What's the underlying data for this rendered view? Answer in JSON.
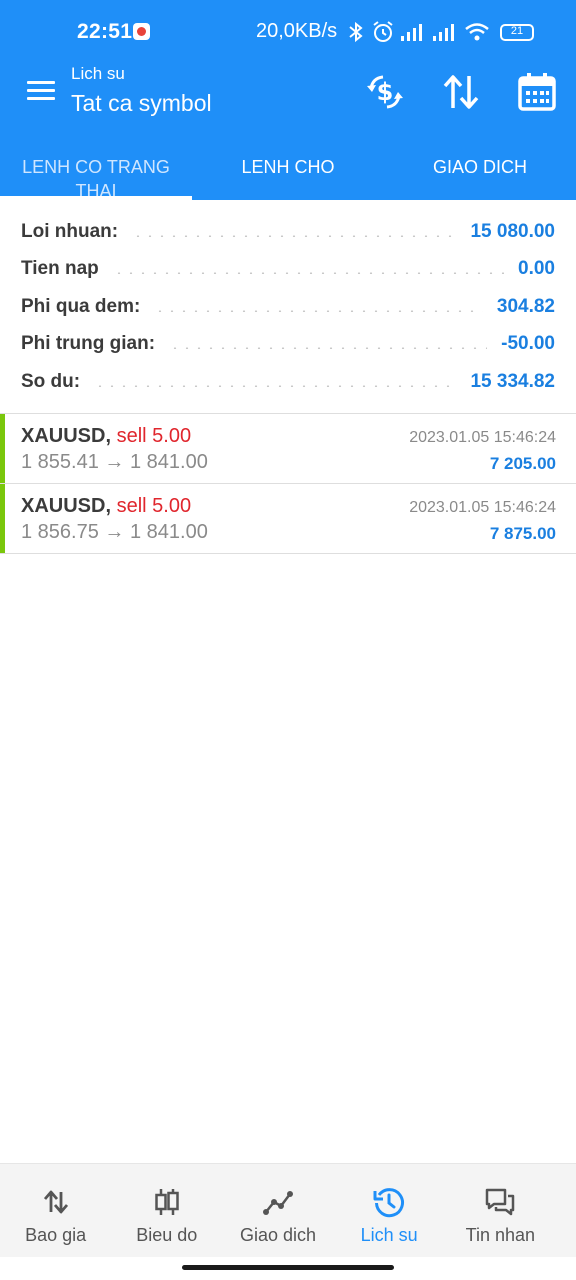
{
  "status_bar": {
    "time": "22:51",
    "speed": "20,0KB/s",
    "battery": "21"
  },
  "header": {
    "subtitle": "Lich su",
    "title": "Tat ca symbol"
  },
  "tabs": [
    {
      "label": "LENH CO TRANG THAI",
      "active": true
    },
    {
      "label": "LENH CHO",
      "active": false
    },
    {
      "label": "GIAO DICH",
      "active": false
    }
  ],
  "summary": [
    {
      "label": "Loi nhuan:",
      "value": "15 080.00"
    },
    {
      "label": "Tien nap",
      "value": "0.00"
    },
    {
      "label": "Phi qua dem:",
      "value": "304.82"
    },
    {
      "label": "Phi trung gian:",
      "value": "-50.00"
    },
    {
      "label": "So du:",
      "value": "15 334.82"
    }
  ],
  "trades": [
    {
      "symbol": "XAUUSD,",
      "side": "sell 5.00",
      "prices": "1 855.41 → 1 841.00",
      "date": "2023.01.05 15:46:24",
      "profit": "7 205.00"
    },
    {
      "symbol": "XAUUSD,",
      "side": "sell 5.00",
      "prices": "1 856.75 → 1 841.00",
      "date": "2023.01.05 15:46:24",
      "profit": "7 875.00"
    }
  ],
  "bottom_nav": [
    {
      "label": "Bao gia",
      "icon": "quotes-arrows-icon",
      "active": false
    },
    {
      "label": "Bieu do",
      "icon": "candlestick-icon",
      "active": false
    },
    {
      "label": "Giao dich",
      "icon": "trade-line-icon",
      "active": false
    },
    {
      "label": "Lich su",
      "icon": "history-clock-icon",
      "active": true
    },
    {
      "label": "Tin nhan",
      "icon": "chat-bubbles-icon",
      "active": false
    }
  ],
  "colors": {
    "primary": "#1f8ff8",
    "profit_blue": "#1a7fe0",
    "sell_red": "#e0262d",
    "trade_bar_green": "#7ac70c"
  }
}
